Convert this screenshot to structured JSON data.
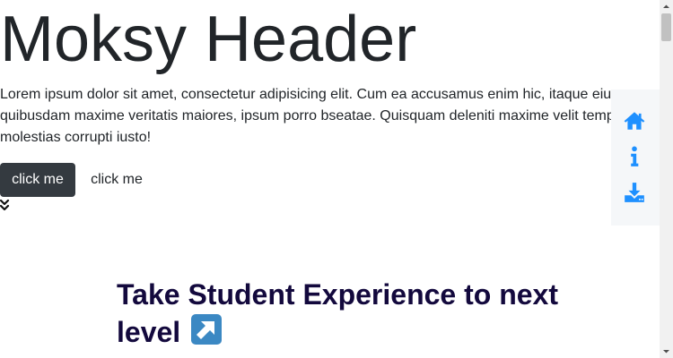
{
  "header": {
    "title": "Moksy Header",
    "lead": "Lorem ipsum dolor sit amet, consectetur adipisicing elit. Cum ea accusamus enim hic, itaque eius quibusdam maxime veritatis maiores, ipsum porro bseatae. Quisquam deleniti maxime velit tempore molestias corrupti iusto!"
  },
  "actions": {
    "primary_label": "click me",
    "secondary_label": "click me"
  },
  "side_nav": {
    "items": [
      {
        "icon": "home-icon",
        "color": "#1e90ff"
      },
      {
        "icon": "info-icon",
        "color": "#1e90ff"
      },
      {
        "icon": "download-icon",
        "color": "#1e90ff"
      }
    ]
  },
  "section": {
    "heading": "Take Student Experience to next level",
    "heading_emoji": "north-east-arrow-emoji",
    "heading_color": "#13093d"
  },
  "colors": {
    "primary_button": "#343a40",
    "accent": "#1e90ff",
    "side_panel": "#f5f7f9"
  }
}
